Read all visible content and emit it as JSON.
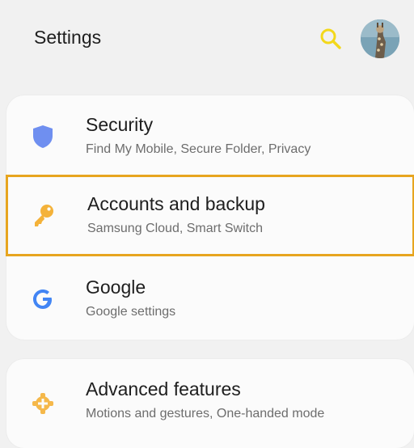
{
  "header": {
    "title": "Settings",
    "search_icon": "search-icon",
    "avatar": "giraffe-avatar"
  },
  "items": [
    {
      "title": "Security",
      "subtitle": "Find My Mobile, Secure Folder, Privacy",
      "icon": "shield-icon",
      "icon_color": "#6f8ff0"
    },
    {
      "title": "Accounts and backup",
      "subtitle": "Samsung Cloud, Smart Switch",
      "icon": "key-icon",
      "icon_color": "#f4b239",
      "selected": true,
      "highlight_color": "#e7a51f"
    },
    {
      "title": "Google",
      "subtitle": "Google settings",
      "icon": "google-icon",
      "icon_color": "#4285f4"
    },
    {
      "title": "Advanced features",
      "subtitle": "Motions and gestures, One-handed mode",
      "icon": "puzzle-icon",
      "icon_color": "#f5b84a"
    }
  ],
  "colors": {
    "background": "#f1f1f1",
    "card": "#fbfbfb",
    "search": "#f3d81b"
  }
}
